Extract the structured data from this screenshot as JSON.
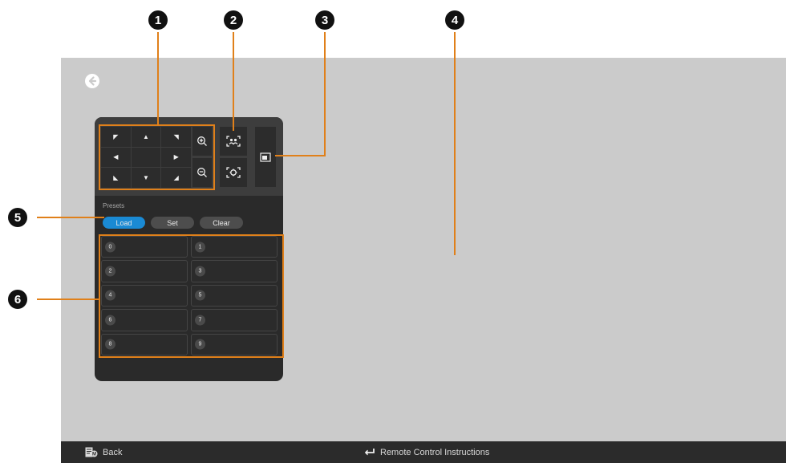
{
  "screen": {
    "back_icon": "arrow-left-circle-icon"
  },
  "ptz": {
    "dpad": [
      {
        "glyph": "◤",
        "name": "pan-up-left-button"
      },
      {
        "glyph": "▲",
        "name": "pan-up-button"
      },
      {
        "glyph": "◥",
        "name": "pan-up-right-button"
      },
      {
        "glyph": "◀",
        "name": "pan-left-button"
      },
      {
        "glyph": "",
        "name": "dpad-center"
      },
      {
        "glyph": "▶",
        "name": "pan-right-button"
      },
      {
        "glyph": "◣",
        "name": "pan-down-left-button"
      },
      {
        "glyph": "▼",
        "name": "pan-down-button"
      },
      {
        "glyph": "◢",
        "name": "pan-down-right-button"
      }
    ],
    "zoom_in_icon": "zoom-in-icon",
    "zoom_out_icon": "zoom-out-icon",
    "auto_frame_icon": "auto-frame-icon",
    "tracking_icon": "tracking-icon",
    "pip_icon": "picture-in-picture-icon"
  },
  "presets": {
    "label": "Presets",
    "load_label": "Load",
    "set_label": "Set",
    "clear_label": "Clear",
    "items": [
      "0",
      "1",
      "2",
      "3",
      "4",
      "5",
      "6",
      "7",
      "8",
      "9"
    ]
  },
  "footer": {
    "back_label": "Back",
    "back_icon": "menu-key-icon",
    "remote_label": "Remote Control Instructions",
    "remote_icon": "enter-key-icon"
  },
  "callouts": [
    "1",
    "2",
    "3",
    "4",
    "5",
    "6"
  ],
  "colors": {
    "accent": "#1a8ad4",
    "callout_line": "#e0801a",
    "screen_bg": "#cbcbcb",
    "panel_bg": "#2a2a2a"
  }
}
